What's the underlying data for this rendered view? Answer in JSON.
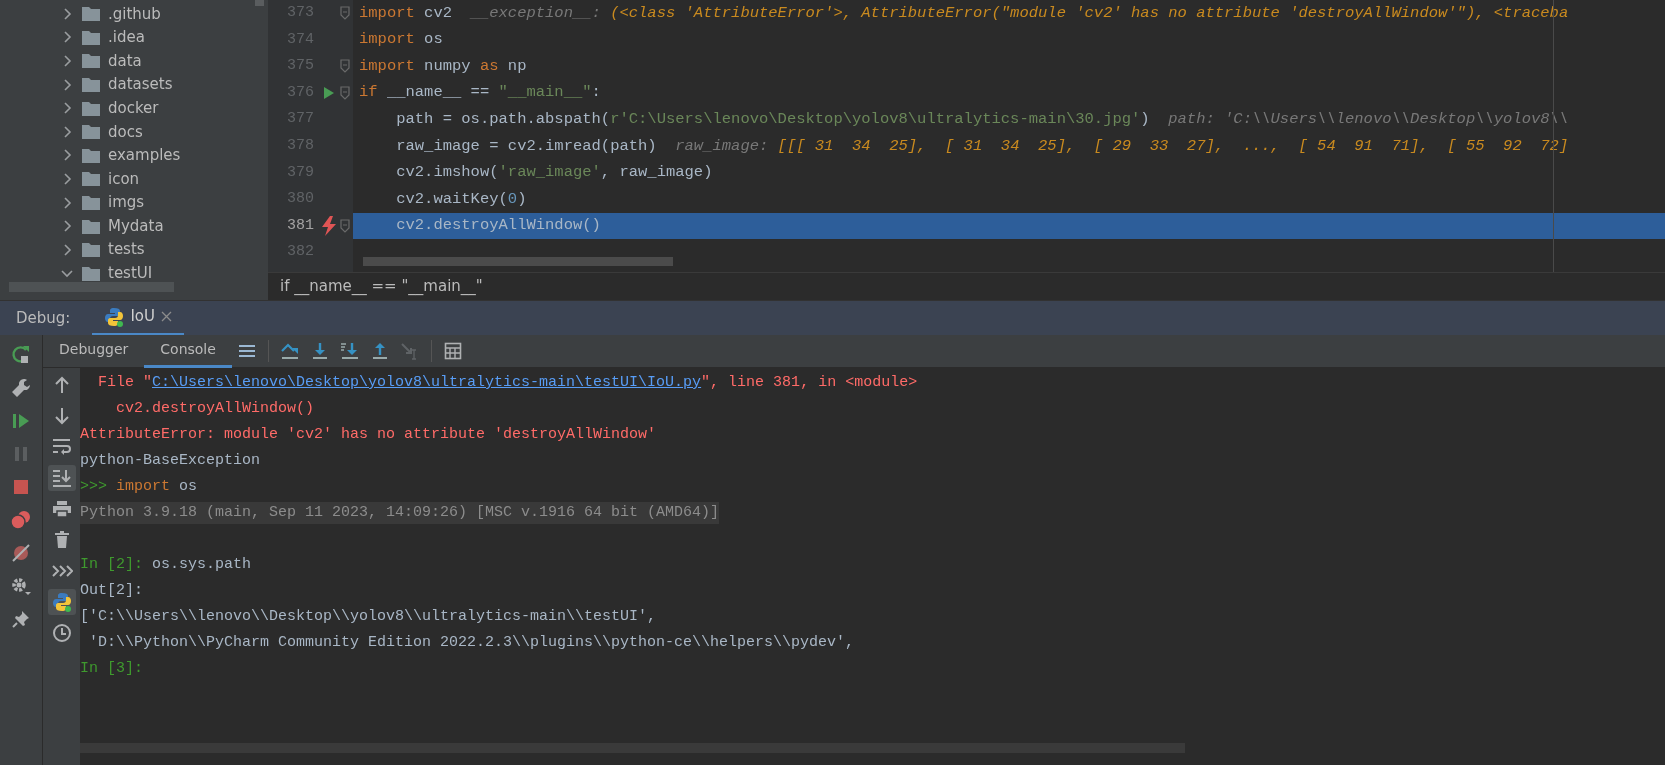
{
  "project_tree": {
    "items": [
      {
        "label": ".github",
        "expanded": false
      },
      {
        "label": ".idea",
        "expanded": false
      },
      {
        "label": "data",
        "expanded": false
      },
      {
        "label": "datasets",
        "expanded": false
      },
      {
        "label": "docker",
        "expanded": false
      },
      {
        "label": "docs",
        "expanded": false
      },
      {
        "label": "examples",
        "expanded": false
      },
      {
        "label": "icon",
        "expanded": false
      },
      {
        "label": "imgs",
        "expanded": false
      },
      {
        "label": "Mydata",
        "expanded": false
      },
      {
        "label": "tests",
        "expanded": false
      },
      {
        "label": "testUI",
        "expanded": true
      }
    ]
  },
  "editor": {
    "lines": [
      {
        "number": "373",
        "runnable": false,
        "exception": false,
        "fold": true,
        "selected": false,
        "tokens": [
          {
            "t": "import",
            "kind": "kw"
          },
          {
            "t": " cv2  ",
            "kind": "plain"
          },
          {
            "t": "__exception__: ",
            "kind": "hint-name"
          },
          {
            "t": "(<class 'AttributeError'>, AttributeError(\"module 'cv2' has no attribute 'destroyAllWindow'\"), <traceba",
            "kind": "hint-value"
          }
        ]
      },
      {
        "number": "374",
        "runnable": false,
        "exception": false,
        "fold": false,
        "selected": false,
        "tokens": [
          {
            "t": "import",
            "kind": "kw"
          },
          {
            "t": " os",
            "kind": "plain"
          }
        ]
      },
      {
        "number": "375",
        "runnable": false,
        "exception": false,
        "fold": true,
        "selected": false,
        "tokens": [
          {
            "t": "import",
            "kind": "kw"
          },
          {
            "t": " numpy ",
            "kind": "plain"
          },
          {
            "t": "as",
            "kind": "kw"
          },
          {
            "t": " np",
            "kind": "plain"
          }
        ]
      },
      {
        "number": "376",
        "runnable": true,
        "exception": false,
        "fold": true,
        "selected": false,
        "tokens": [
          {
            "t": "if",
            "kind": "kw"
          },
          {
            "t": " __name__ == ",
            "kind": "plain"
          },
          {
            "t": "\"__main__\"",
            "kind": "str"
          },
          {
            "t": ":",
            "kind": "plain"
          }
        ]
      },
      {
        "number": "377",
        "runnable": false,
        "exception": false,
        "fold": false,
        "selected": false,
        "tokens": [
          {
            "t": "    path = os.path.abspath(",
            "kind": "plain"
          },
          {
            "t": "r'C:\\Users\\lenovo\\Desktop\\yolov8\\ultralytics-main\\30.jpg'",
            "kind": "str"
          },
          {
            "t": ")  ",
            "kind": "plain"
          },
          {
            "t": "path: 'C:\\\\Users\\\\lenovo\\\\Desktop\\\\yolov8\\\\",
            "kind": "hint-name"
          }
        ]
      },
      {
        "number": "378",
        "runnable": false,
        "exception": false,
        "fold": false,
        "selected": false,
        "tokens": [
          {
            "t": "    raw_image = cv2.imread(path)  ",
            "kind": "plain"
          },
          {
            "t": "raw_image: ",
            "kind": "hint-name"
          },
          {
            "t": "[[[ 31  34  25],  [ 31  34  25],  [ 29  33  27],  ...,  [ 54  91  71],  [ 55  92  72]",
            "kind": "hint-value"
          }
        ]
      },
      {
        "number": "379",
        "runnable": false,
        "exception": false,
        "fold": false,
        "selected": false,
        "tokens": [
          {
            "t": "    cv2.imshow(",
            "kind": "plain"
          },
          {
            "t": "'raw_image'",
            "kind": "str"
          },
          {
            "t": ", raw_image)",
            "kind": "plain"
          }
        ]
      },
      {
        "number": "380",
        "runnable": false,
        "exception": false,
        "fold": false,
        "selected": false,
        "tokens": [
          {
            "t": "    cv2.waitKey(",
            "kind": "plain"
          },
          {
            "t": "0",
            "kind": "num"
          },
          {
            "t": ")",
            "kind": "plain"
          }
        ]
      },
      {
        "number": "381",
        "runnable": false,
        "exception": true,
        "fold": true,
        "selected": true,
        "tokens": [
          {
            "t": "    cv2.destroyAllWindow()",
            "kind": "plain"
          }
        ]
      },
      {
        "number": "382",
        "runnable": false,
        "exception": false,
        "fold": false,
        "selected": false
      }
    ],
    "breadcrumb": "if __name__ == \"__main__\""
  },
  "debug": {
    "label": "Debug:",
    "tabs": [
      {
        "label": "IoU",
        "selected": true
      }
    ],
    "subtabs": [
      {
        "label": "Debugger",
        "selected": false
      },
      {
        "label": "Console",
        "selected": true
      }
    ]
  },
  "console": {
    "lines": [
      {
        "highlighted": false,
        "gap_before": false,
        "tokens": [
          {
            "t": "  File \"",
            "kind": "err"
          },
          {
            "t": "C:\\Users\\lenovo\\Desktop\\yolov8\\ultralytics-main\\testUI\\IoU.py",
            "kind": "link"
          },
          {
            "t": "\", line 381, in <module>",
            "kind": "err"
          }
        ]
      },
      {
        "highlighted": false,
        "gap_before": false,
        "tokens": [
          {
            "t": "    cv2.destroyAllWindow()",
            "kind": "err"
          }
        ]
      },
      {
        "highlighted": false,
        "gap_before": false,
        "tokens": [
          {
            "t": "AttributeError: module 'cv2' has no attribute 'destroyAllWindow'",
            "kind": "err"
          }
        ]
      },
      {
        "highlighted": false,
        "gap_before": false,
        "tokens": [
          {
            "t": "python-BaseException",
            "kind": "plain"
          }
        ]
      },
      {
        "highlighted": false,
        "gap_before": false,
        "tokens": [
          {
            "t": ">>> ",
            "kind": "prompt"
          },
          {
            "t": "import",
            "kind": "kw"
          },
          {
            "t": " os",
            "kind": "plain"
          }
        ]
      },
      {
        "highlighted": true,
        "gap_before": false,
        "tokens": [
          {
            "t": "Python 3.9.18 (main, Sep 11 2023, 14:09:26) [MSC v.1916 64 bit (AMD64)]",
            "kind": "gray"
          }
        ]
      },
      {
        "highlighted": false,
        "gap_before": true,
        "tokens": [
          {
            "t": "In [2]: ",
            "kind": "prompt"
          },
          {
            "t": "os.sys.path",
            "kind": "plain"
          }
        ]
      },
      {
        "highlighted": false,
        "gap_before": false,
        "tokens": [
          {
            "t": "Out[2]:",
            "kind": "plain"
          }
        ]
      },
      {
        "highlighted": false,
        "gap_before": false,
        "tokens": [
          {
            "t": "['C:\\\\Users\\\\lenovo\\\\Desktop\\\\yolov8\\\\ultralytics-main\\\\testUI',",
            "kind": "plain"
          }
        ]
      },
      {
        "highlighted": false,
        "gap_before": false,
        "tokens": [
          {
            "t": " 'D:\\\\Python\\\\PyCharm Community Edition 2022.2.3\\\\plugins\\\\python-ce\\\\helpers\\\\pydev',",
            "kind": "plain"
          }
        ]
      },
      {
        "highlighted": false,
        "gap_before": false,
        "tokens": [
          {
            "t": "In [3]:",
            "kind": "prompt"
          }
        ]
      }
    ]
  }
}
